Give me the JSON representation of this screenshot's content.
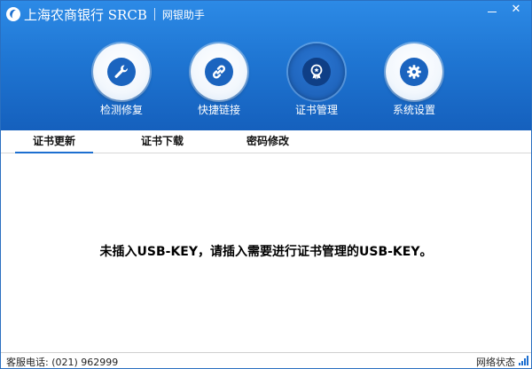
{
  "app": {
    "bank_name": "上海农商银行 SRCB",
    "subtitle": "网银助手",
    "close_symbol": "✕"
  },
  "colors": {
    "header_blue": "#1f76d3",
    "accent": "#1d6fd0",
    "active_tool": "#1a5cb2"
  },
  "tools": [
    {
      "label": "检测修复",
      "icon": "wrench-icon"
    },
    {
      "label": "快捷链接",
      "icon": "link-icon"
    },
    {
      "label": "证书管理",
      "icon": "certificate-icon",
      "active": true
    },
    {
      "label": "系统设置",
      "icon": "gear-icon"
    }
  ],
  "tabs": [
    {
      "label": "证书更新",
      "active": true
    },
    {
      "label": "证书下载"
    },
    {
      "label": "密码修改"
    }
  ],
  "main": {
    "message": "未插入USB-KEY，请插入需要进行证书管理的USB-KEY。"
  },
  "status": {
    "hotline": "客服电话: (021) 962999",
    "network": "网络状态",
    "network_icon": "signal-icon"
  }
}
